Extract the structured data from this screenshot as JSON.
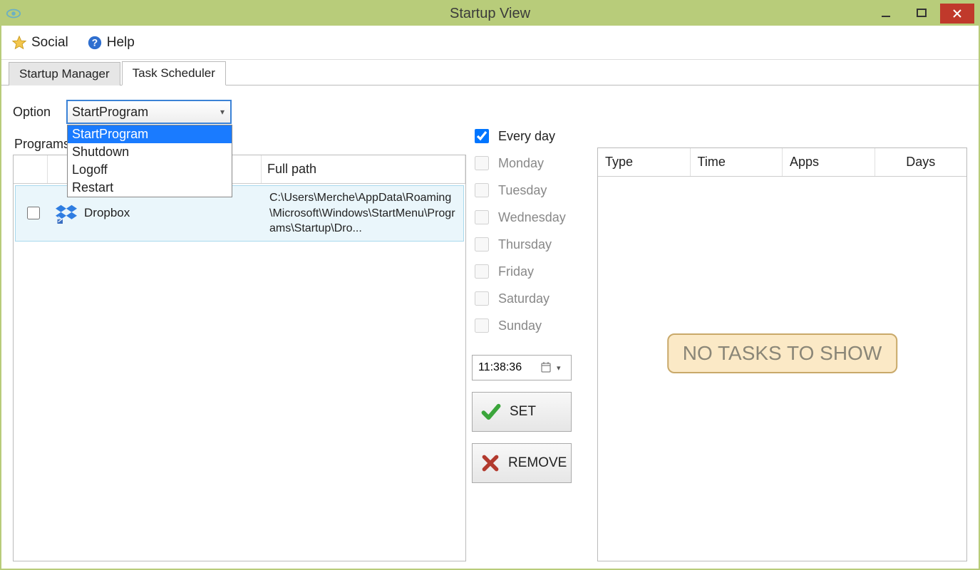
{
  "window": {
    "title": "Startup View"
  },
  "menubar": {
    "social": "Social",
    "help": "Help"
  },
  "tabs": {
    "startup_manager": "Startup Manager",
    "task_scheduler": "Task Scheduler",
    "active": "task_scheduler"
  },
  "option": {
    "label": "Option",
    "selected": "StartProgram",
    "items": [
      "StartProgram",
      "Shutdown",
      "Logoff",
      "Restart"
    ]
  },
  "programs": {
    "label": "Programs",
    "columns": {
      "chk": "",
      "name": "",
      "full_path": "Full path"
    },
    "rows": [
      {
        "checked": false,
        "name": "Dropbox",
        "path": "C:\\Users\\Merche\\AppData\\Roaming\\Microsoft\\Windows\\StartMenu\\Programs\\Startup\\Dro..."
      }
    ]
  },
  "days": {
    "every_day": {
      "label": "Every day",
      "checked": true
    },
    "items": [
      {
        "label": "Monday",
        "checked": false
      },
      {
        "label": "Tuesday",
        "checked": false
      },
      {
        "label": "Wednesday",
        "checked": false
      },
      {
        "label": "Thursday",
        "checked": false
      },
      {
        "label": "Friday",
        "checked": false
      },
      {
        "label": "Saturday",
        "checked": false
      },
      {
        "label": "Sunday",
        "checked": false
      }
    ]
  },
  "time": {
    "value": "11:38:36"
  },
  "buttons": {
    "set": "SET",
    "remove": "REMOVE"
  },
  "tasks": {
    "columns": {
      "type": "Type",
      "time": "Time",
      "apps": "Apps",
      "days": "Days"
    },
    "empty_message": "NO TASKS TO SHOW"
  }
}
